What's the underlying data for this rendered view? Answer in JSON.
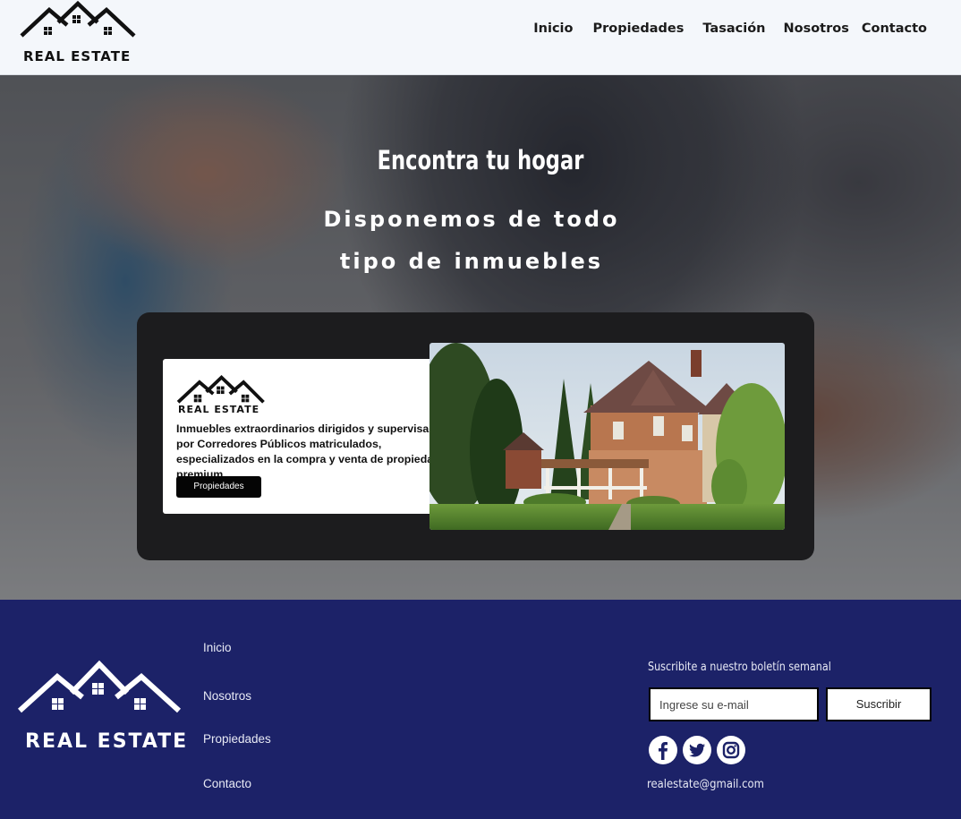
{
  "header": {
    "logo_text": "REAL ESTATE",
    "nav": [
      "Inicio",
      "Propiedades",
      "Tasación",
      "Nosotros",
      "Contacto"
    ]
  },
  "hero": {
    "title": "Encontra tu hogar",
    "subtitle": "Disponemos de todo tipo de inmuebles",
    "card": {
      "logo_text": "REAL ESTATE",
      "description": "Inmuebles extraordinarios dirigidos y supervisados por Corredores Públicos matriculados, especializados en la compra y venta de propiedades premium",
      "button_label": "Propiedades"
    }
  },
  "footer": {
    "logo_text": "REAL ESTATE",
    "links": [
      "Inicio",
      "Nosotros",
      "Propiedades",
      "Contacto"
    ],
    "newsletter": {
      "label": "Suscribite a nuestro boletín semanal",
      "placeholder": "Ingrese su e-mail",
      "button_label": "Suscribir"
    },
    "social_icons": [
      "facebook-icon",
      "twitter-icon",
      "instagram-icon"
    ],
    "email": "realestate@gmail.com"
  },
  "colors": {
    "header_bg": "#f4f7fb",
    "footer_bg": "#1c2268",
    "card_bg": "#1c1c1e",
    "button_bg": "#050505"
  }
}
